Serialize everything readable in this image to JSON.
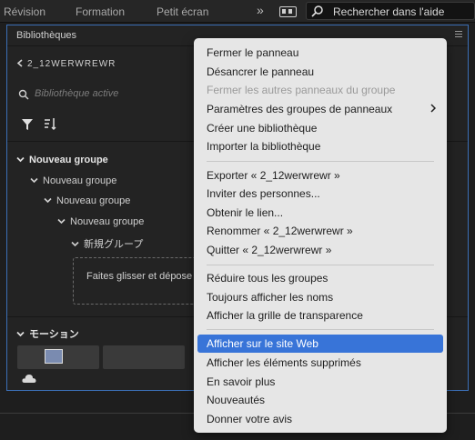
{
  "topbar": {
    "tabs": [
      "Révision",
      "Formation",
      "Petit écran"
    ],
    "search_text": "Rechercher dans l'aide"
  },
  "panel": {
    "title": "Bibliothèques",
    "breadcrumb": "2_12WERWREWR",
    "search_placeholder": "Bibliothèque active",
    "tree": [
      "Nouveau groupe",
      "Nouveau groupe",
      "Nouveau groupe",
      "Nouveau groupe",
      "新規グループ"
    ],
    "drop_text": "Faites glisser et dépose",
    "motion_group": "モーション"
  },
  "menu": {
    "group1": [
      "Fermer le panneau",
      "Désancrer le panneau",
      "Fermer les autres panneaux du groupe",
      "Paramètres des groupes de panneaux",
      "Créer une bibliothèque",
      "Importer la bibliothèque"
    ],
    "group2": [
      "Exporter « 2_12werwrewr »",
      "Inviter des personnes...",
      "Obtenir le lien...",
      "Renommer « 2_12werwrewr »",
      "Quitter « 2_12werwrewr »"
    ],
    "group3": [
      "Réduire tous les groupes",
      "Toujours afficher les noms",
      "Afficher la grille de transparence"
    ],
    "group4": [
      "Afficher sur le site Web",
      "Afficher les éléments supprimés",
      "En savoir plus",
      "Nouveautés",
      "Donner votre avis"
    ]
  },
  "colors": {
    "accent": "#3874d8",
    "panel_border": "#3b6fb6"
  }
}
